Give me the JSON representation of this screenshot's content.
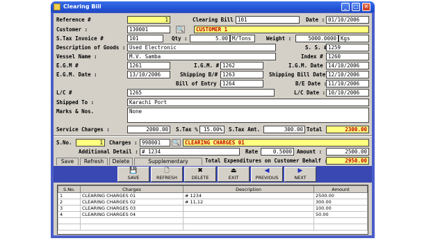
{
  "window": {
    "title": "Clearing Bill"
  },
  "form": {
    "reference_label": "Reference #",
    "reference": "1",
    "clearing_bill_label": "Clearing Bill #",
    "clearing_bill": "101",
    "date_label": "Date :",
    "date": "01/10/2006",
    "customer_label": "Customer :",
    "customer_code": "130001",
    "customer_name": "CUSTOMER 1",
    "stax_invoice_label": "S.Tax Invoice #",
    "stax_invoice": "101",
    "qty_label": "Qty :",
    "qty": "5.00",
    "qty_unit": "M/Tons",
    "weight_label": "Weight :",
    "weight": "5000.0000",
    "weight_unit": "Kgs",
    "goods_label": "Description of Goods :",
    "goods": "Used Electronic",
    "ss_label": "S. S. #",
    "ss": "1259",
    "vessel_label": "Vessel Name :",
    "vessel": "M.V. Samba",
    "index_label": "Index #",
    "index": "1260",
    "egm_label": "E.G.M #",
    "egm": "1261",
    "igm_label": "I.G.M. #",
    "igm": "1262",
    "igm_date_label": "I.G.M. Date :",
    "igm_date": "14/10/2006",
    "egm_date_label": "E.G.M. Date :",
    "egm_date": "13/10/2006",
    "shipping_label": "Shipping B/#",
    "shipping": "1263",
    "shipping_date_label": "Shipping Bill Date :",
    "shipping_date": "12/10/2006",
    "entry_label": "Bill of Entry #",
    "entry": "1264",
    "be_date_label": "B/E Date :",
    "be_date": "11/10/2006",
    "lc_label": "L/C #",
    "lc": "1265",
    "lc_date_label": "L/C Date :",
    "lc_date": "10/10/2006",
    "shipped_label": "Shipped To :",
    "shipped": "Karachi Port",
    "marks_label": "Marks & Nos.",
    "marks": "None",
    "service_label": "Service Charges :",
    "service": "2000.00",
    "stax_pct_label": "S.Tax %",
    "stax_pct": "15.00%",
    "stax_amt_label": "S.Tax Amt. :",
    "stax_amt": "300.00",
    "total_label": "Total :",
    "total": "2300.00"
  },
  "detail": {
    "sno_label": "S.No. :",
    "sno": "1",
    "charges_label": "Charges :",
    "charges_code": "998001",
    "charges_name": "CLEARING CHARGES 01",
    "additional_label": "Additional Detail :",
    "additional": "# 1234",
    "rate_label": "Rate :",
    "rate": "0.5000",
    "amount_label": "Amount :",
    "amount": "2500.00",
    "total_exp_label": "Total Expenditures on Customer Behalf :",
    "total_exp": "2950.00"
  },
  "tabs": [
    "Save",
    "Refresh",
    "Delete",
    "Supplementary Charges"
  ],
  "toolbar": [
    {
      "label": "SAVE",
      "icon": "floppy-icon"
    },
    {
      "label": "REFRESH",
      "icon": "document-icon"
    },
    {
      "label": "DELETE",
      "icon": "delete-x-icon"
    },
    {
      "label": "EXIT",
      "icon": "exit-icon"
    },
    {
      "label": "PREVIOUS",
      "icon": "left-arrow-icon"
    },
    {
      "label": "NEXT",
      "icon": "right-arrow-icon"
    }
  ],
  "grid": {
    "headers": [
      "S.No.",
      "Charges",
      "Description",
      "Amount"
    ],
    "rows": [
      [
        "1",
        "CLEARING CHARGES 01",
        "# 1234",
        "2500.00"
      ],
      [
        "2",
        "CLEARING CHARGES 02",
        "# 11,12",
        "300.00"
      ],
      [
        "3",
        "CLEARING CHARGES 03",
        "",
        "100.00"
      ],
      [
        "4",
        "CLEARING CHARGES 04",
        "",
        "50.00"
      ]
    ]
  },
  "colors": {
    "titlebar": "#2454d6",
    "highlight": "#ffff80",
    "accent_text": "#c00000",
    "toolbar_bg": "#3a48b4"
  }
}
